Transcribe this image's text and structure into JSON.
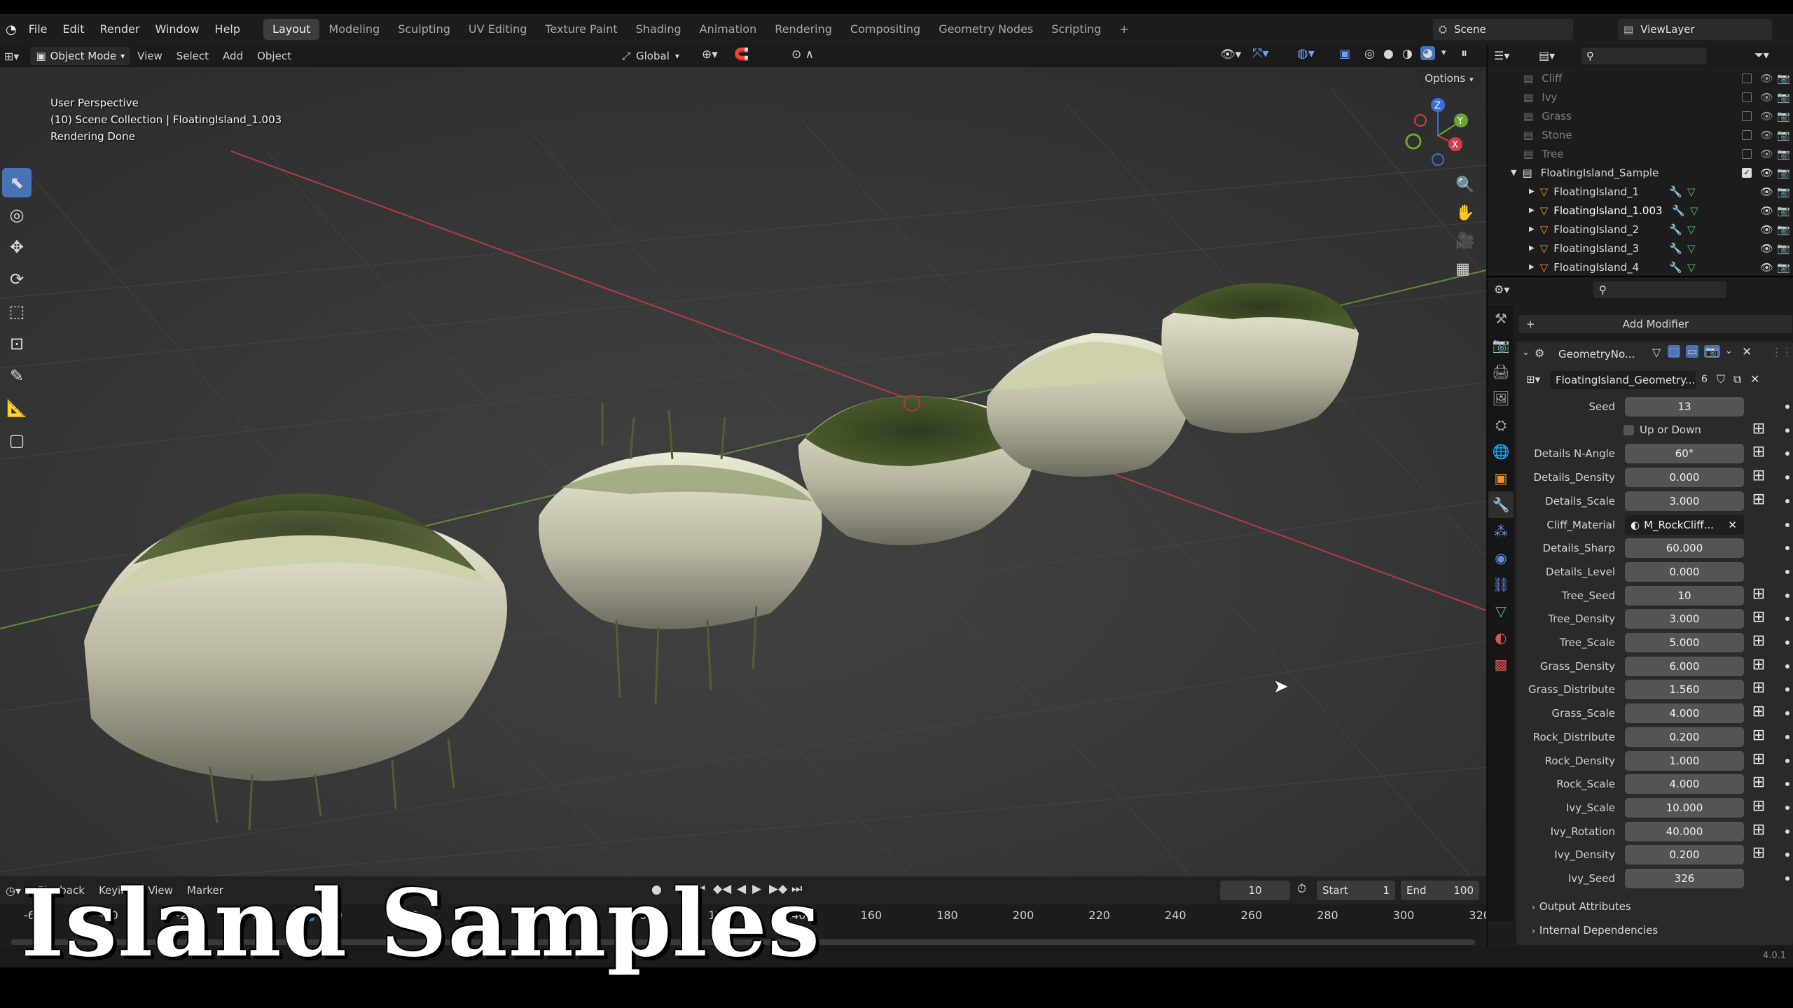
{
  "app": {
    "menus": [
      "File",
      "Edit",
      "Render",
      "Window",
      "Help"
    ],
    "workspaces": [
      "Layout",
      "Modeling",
      "Sculpting",
      "UV Editing",
      "Texture Paint",
      "Shading",
      "Animation",
      "Rendering",
      "Compositing",
      "Geometry Nodes",
      "Scripting"
    ],
    "active_workspace": "Layout",
    "add_workspace": "+",
    "scene": "Scene",
    "view_layer": "ViewLayer",
    "version": "4.0.1"
  },
  "header": {
    "mode": "Object Mode",
    "view": "View",
    "select": "Select",
    "add": "Add",
    "object": "Object",
    "orientation": "Global",
    "options": "Options"
  },
  "viewport": {
    "perspective": "User Perspective",
    "collection_info": "(10) Scene Collection | FloatingIsland_1.003",
    "status": "Rendering Done",
    "gizmo": {
      "x": "X",
      "y": "Y",
      "z": "Z"
    }
  },
  "outliner": {
    "hidden_items": [
      "Cliff",
      "Ivy",
      "Grass",
      "Stone",
      "Tree"
    ],
    "collection": "FloatingIsland_Sample",
    "objects": [
      "FloatingIsland_1",
      "FloatingIsland_1.003",
      "FloatingIsland_2",
      "FloatingIsland_3",
      "FloatingIsland_4"
    ]
  },
  "properties": {
    "add_modifier": "Add Modifier",
    "modifier_name": "GeometryNo...",
    "node_group": "FloatingIsland_Geometry...",
    "node_group_users": "6",
    "fields": [
      {
        "label": "Seed",
        "value": "13",
        "mark": ""
      },
      {
        "label": "",
        "value": "Up or Down",
        "mark": "⊞",
        "checkbox": true
      },
      {
        "label": "Details N-Angle",
        "value": "60°",
        "mark": "⊞"
      },
      {
        "label": "Details_Density",
        "value": "0.000",
        "mark": "⊞"
      },
      {
        "label": "Details_Scale",
        "value": "3.000",
        "mark": "⊞"
      },
      {
        "label": "Cliff_Material",
        "value": "M_RockCliff...",
        "mark": "",
        "material": true
      },
      {
        "label": "Details_Sharp",
        "value": "60.000",
        "mark": ""
      },
      {
        "label": "Details_Level",
        "value": "0.000",
        "mark": ""
      },
      {
        "label": "Tree_Seed",
        "value": "10",
        "mark": "⊞"
      },
      {
        "label": "Tree_Density",
        "value": "3.000",
        "mark": "⊞"
      },
      {
        "label": "Tree_Scale",
        "value": "5.000",
        "mark": "⊞"
      },
      {
        "label": "Grass_Density",
        "value": "6.000",
        "mark": "⊞"
      },
      {
        "label": "Grass_Distribute",
        "value": "1.560",
        "mark": "⊞"
      },
      {
        "label": "Grass_Scale",
        "value": "4.000",
        "mark": "⊞"
      },
      {
        "label": "Rock_Distribute",
        "value": "0.200",
        "mark": "⊞"
      },
      {
        "label": "Rock_Density",
        "value": "1.000",
        "mark": "⊞"
      },
      {
        "label": "Rock_Scale",
        "value": "4.000",
        "mark": "⊞"
      },
      {
        "label": "Ivy_Scale",
        "value": "10.000",
        "mark": "⊞"
      },
      {
        "label": "Ivy_Rotation",
        "value": "40.000",
        "mark": "⊞"
      },
      {
        "label": "Ivy_Density",
        "value": "0.200",
        "mark": "⊞"
      },
      {
        "label": "Ivy_Seed",
        "value": "326",
        "mark": ""
      }
    ],
    "output_attributes": "Output Attributes",
    "internal_dependencies": "Internal Dependencies"
  },
  "timeline": {
    "menus": [
      "Playback",
      "Keying",
      "View",
      "Marker"
    ],
    "current_frame": "10",
    "start_label": "Start",
    "start": "1",
    "end_label": "End",
    "end": "100",
    "ticks": [
      "-60",
      "-40",
      "-20",
      "0",
      "20",
      "40",
      "60",
      "80",
      "100",
      "120",
      "140",
      "160",
      "180",
      "200",
      "220",
      "240",
      "260",
      "280",
      "300",
      "320"
    ],
    "playhead": "10"
  },
  "title_overlay": "Island Samples"
}
